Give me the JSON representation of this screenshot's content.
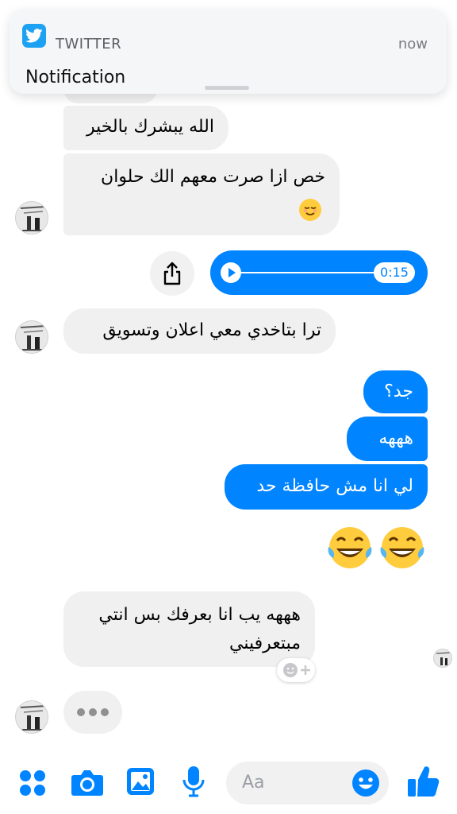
{
  "notification": {
    "app_name": "TWITTER",
    "time": "now",
    "body": "Notification"
  },
  "messages": [
    {
      "side": "incoming",
      "text": "الله يبشرك بالخير"
    },
    {
      "side": "incoming",
      "text": "خص ازا صرت معهم الك حلوان"
    },
    {
      "side": "outgoing",
      "type": "audio",
      "duration": "0:15"
    },
    {
      "side": "incoming",
      "text": "ترا بتاخدي معي اعلان وتسويق"
    },
    {
      "side": "outgoing",
      "text": "جد؟"
    },
    {
      "side": "outgoing",
      "text": "هههه"
    },
    {
      "side": "outgoing",
      "text": "لي انا مش حافظة حد"
    },
    {
      "side": "outgoing",
      "type": "emoji",
      "emoji": "tears-of-joy x2"
    },
    {
      "side": "incoming",
      "text_line1": "هههه يب انا بعرفك بس انتي",
      "text_line2": "مبتعرفيني"
    },
    {
      "side": "incoming",
      "type": "typing-indicator"
    }
  ],
  "composer": {
    "placeholder": "Aa",
    "icons": [
      "apps-icon",
      "camera-icon",
      "image-icon",
      "microphone-icon",
      "emoji-icon",
      "like-icon"
    ]
  },
  "colors": {
    "messenger_blue": "#0084ff",
    "incoming_bubble": "#f1f0f0",
    "twitter_blue": "#1da1f2"
  }
}
